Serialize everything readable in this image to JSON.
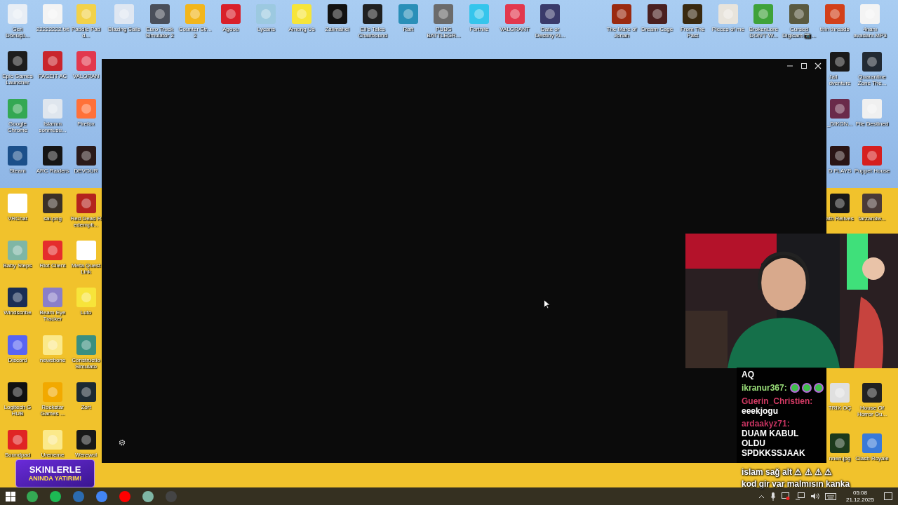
{
  "desktop": {
    "left_grid": [
      {
        "label": "Geri Dönüşü...",
        "color": "#e8eef5"
      },
      {
        "label": "22222222.txt",
        "color": "#f4f4f4"
      },
      {
        "label": "Paddle Padd...",
        "color": "#f2d24a"
      },
      {
        "label": "Epic Games Launcher",
        "color": "#1d1d1d"
      },
      {
        "label": "FACEIT AC",
        "color": "#c9252c"
      },
      {
        "label": "VALORAN",
        "color": "#e2384d"
      },
      {
        "label": "Google Chrome",
        "color": "#34a853"
      },
      {
        "label": "İslamın sonmusu...",
        "color": "#dfe6ee"
      },
      {
        "label": "Firefox",
        "color": "#ff7139"
      },
      {
        "label": "Steam",
        "color": "#1b4f8a"
      },
      {
        "label": "ARC Raiders",
        "color": "#151515"
      },
      {
        "label": "DEVOUR",
        "color": "#2a1a1a"
      },
      {
        "label": "VRChat",
        "color": "#ffffff"
      },
      {
        "label": "sai.png",
        "color": "#3b3128"
      },
      {
        "label": "Red Dead Redempti...",
        "color": "#b4231e"
      },
      {
        "label": "Baby Steps",
        "color": "#7fb6a5"
      },
      {
        "label": "Riot Client",
        "color": "#e52d2d"
      },
      {
        "label": "Meta Quest Link",
        "color": "#ffffff"
      },
      {
        "label": "Windscribe",
        "color": "#1b2e55"
      },
      {
        "label": "Beam Eye Tracker",
        "color": "#8a7fc8"
      },
      {
        "label": "Luto",
        "color": "#f7e43a"
      },
      {
        "label": "Discord",
        "color": "#5865f2"
      },
      {
        "label": "newsbone",
        "color": "#fbe98a"
      },
      {
        "label": "Constructio Simulato",
        "color": "#3b8f80"
      },
      {
        "label": "Logitech G HUB",
        "color": "#111111"
      },
      {
        "label": "Rockstar Games ...",
        "color": "#f2a900"
      },
      {
        "label": "Zort",
        "color": "#1c2a33"
      },
      {
        "label": "Soundpad",
        "color": "#e02424"
      },
      {
        "label": "Ureneme",
        "color": "#fbe98a"
      },
      {
        "label": "Werewol",
        "color": "#191919"
      }
    ],
    "top_left": [
      {
        "label": "Blazing Sails",
        "color": "#dfe7f2"
      },
      {
        "label": "Euro Truck Simulator 2",
        "color": "#4a4f5a"
      },
      {
        "label": "Counter Str... 2",
        "color": "#f2b61c"
      },
      {
        "label": "Agoou",
        "color": "#d9202a"
      },
      {
        "label": "Lycans",
        "color": "#9cc9e0"
      },
      {
        "label": "Among Us",
        "color": "#f6e53a"
      },
      {
        "label": "Zalimahel",
        "color": "#121212"
      },
      {
        "label": "Ell's Tales Chairbound",
        "color": "#202020"
      },
      {
        "label": "Raft",
        "color": "#2a8fb8"
      },
      {
        "label": "PUBG BATTLEGR...",
        "color": "#6b6b6b"
      },
      {
        "label": "Fortnite",
        "color": "#35c5ec"
      },
      {
        "label": "VALORANT",
        "color": "#e2384d"
      },
      {
        "label": "Date or Destiny Ki...",
        "color": "#3a3a6a"
      }
    ],
    "top_right": [
      {
        "label": "The Mare of Jonah",
        "color": "#9a2a10"
      },
      {
        "label": "Dream Cage",
        "color": "#4a2020"
      },
      {
        "label": "From The Past",
        "color": "#3a2a10"
      },
      {
        "label": "Pieces of me",
        "color": "#e8e4dc"
      },
      {
        "label": "BrokenLore DON'T W...",
        "color": "#3fa23a"
      },
      {
        "label": "Cursed Digicam 📷...",
        "color": "#5a5a40"
      },
      {
        "label": "thin threads",
        "color": "#d2401a"
      },
      {
        "label": "4nanı avadanı.MP3",
        "color": "#f4f4f4"
      }
    ],
    "right_column": [
      {
        "label": "Jail\ndventure",
        "color": "#1a1a1a"
      },
      {
        "label": "Quarantine Zone The...",
        "color": "#222a33"
      },
      {
        "label": "_DIKON...",
        "color": "#6a2a4a"
      },
      {
        "label": "File Destined",
        "color": "#f0f0f0"
      },
      {
        "label": "D FLAYS",
        "color": "#2a1515"
      },
      {
        "label": "Puppet House",
        "color": "#d61f1f"
      },
      {
        "label": "ath Relives",
        "color": "#181818"
      },
      {
        "label": "tarzan3w...",
        "color": "#4a3a38"
      },
      {
        "label": "TRIX OÇ",
        "color": "#e0e0e0"
      },
      {
        "label": "House Of Horror Ou...",
        "color": "#222222"
      },
      {
        "label": "nnen.jpg",
        "color": "#1c3a1c"
      },
      {
        "label": "Clash Royale",
        "color": "#3a7ad8"
      }
    ]
  },
  "chat": {
    "messages": [
      {
        "kind": "continuation",
        "text": "AQ"
      },
      {
        "kind": "emotes",
        "user": "ikranur367:",
        "color": "#9be07a"
      },
      {
        "kind": "message",
        "user": "Guerin_Christien:",
        "color": "#d33a64",
        "text": "eeekjogu"
      },
      {
        "kind": "message",
        "user": "ardaakyz71:",
        "color": "#c73461",
        "text": "DUAM KABUL OLDU SPDKKSSJAAK"
      },
      {
        "kind": "faded",
        "text": "islam sağ alt ⚠ ⚠ ⚠ ⚠"
      },
      {
        "kind": "faded",
        "text": "kod gir var malmısın kanka"
      }
    ]
  },
  "banner": {
    "title": "SKINLERLE",
    "subtitle": "ANINDA YATIRIM!"
  },
  "taskbar": {
    "pinned": [
      {
        "color": "#34a853"
      },
      {
        "color": "#1db954"
      },
      {
        "color": "#2b6cb0"
      },
      {
        "color": "#4285f4"
      },
      {
        "color": "#ff0000"
      },
      {
        "color": "#7fb6a5"
      },
      {
        "color": "#444444"
      }
    ],
    "time": "05:08",
    "date": "21.12.2025"
  }
}
